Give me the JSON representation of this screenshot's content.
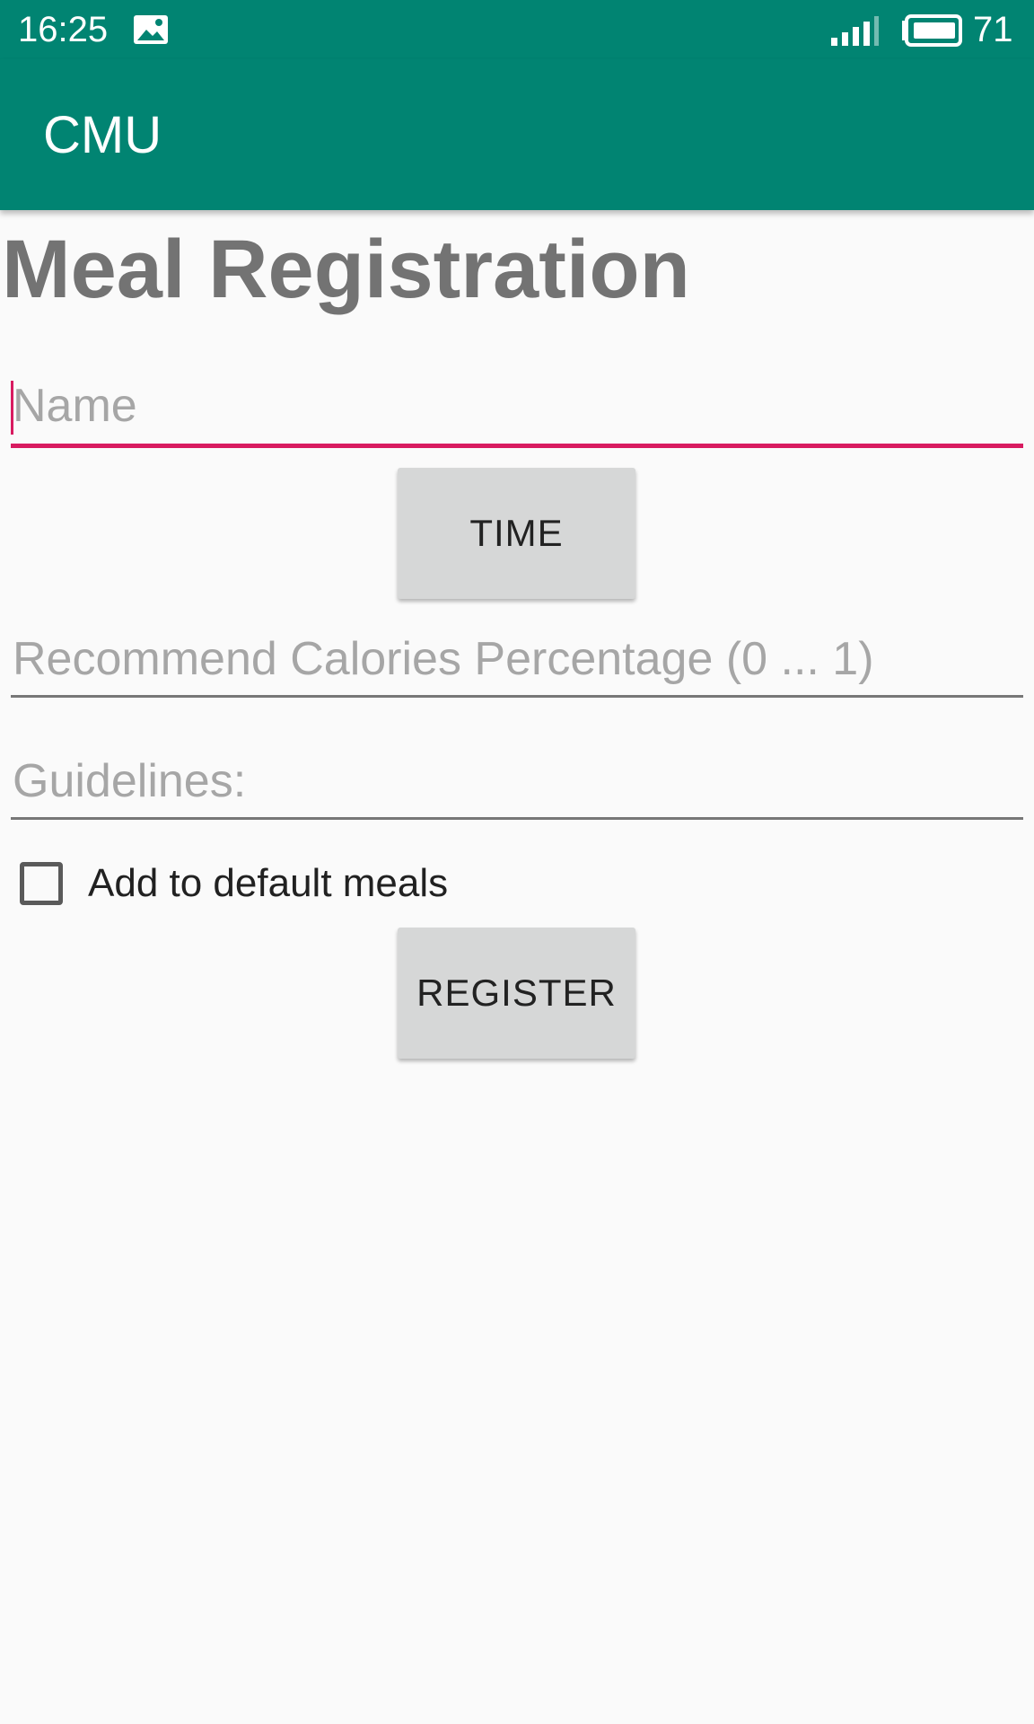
{
  "status_bar": {
    "time": "16:25",
    "battery_level": "71",
    "icons": [
      "image-notification-icon",
      "signal-icon",
      "battery-icon"
    ]
  },
  "app_bar": {
    "title": "CMU",
    "color": "#018472"
  },
  "form": {
    "title": "Meal Registration",
    "name_placeholder": "Name",
    "time_button": "TIME",
    "calories_placeholder": "Recommend Calories Percentage (0 ... 1)",
    "guidelines_placeholder": "Guidelines:",
    "default_meals_label": "Add to default meals",
    "default_meals_checked": false,
    "register_button": "REGISTER",
    "accent_color": "#d81b60"
  }
}
